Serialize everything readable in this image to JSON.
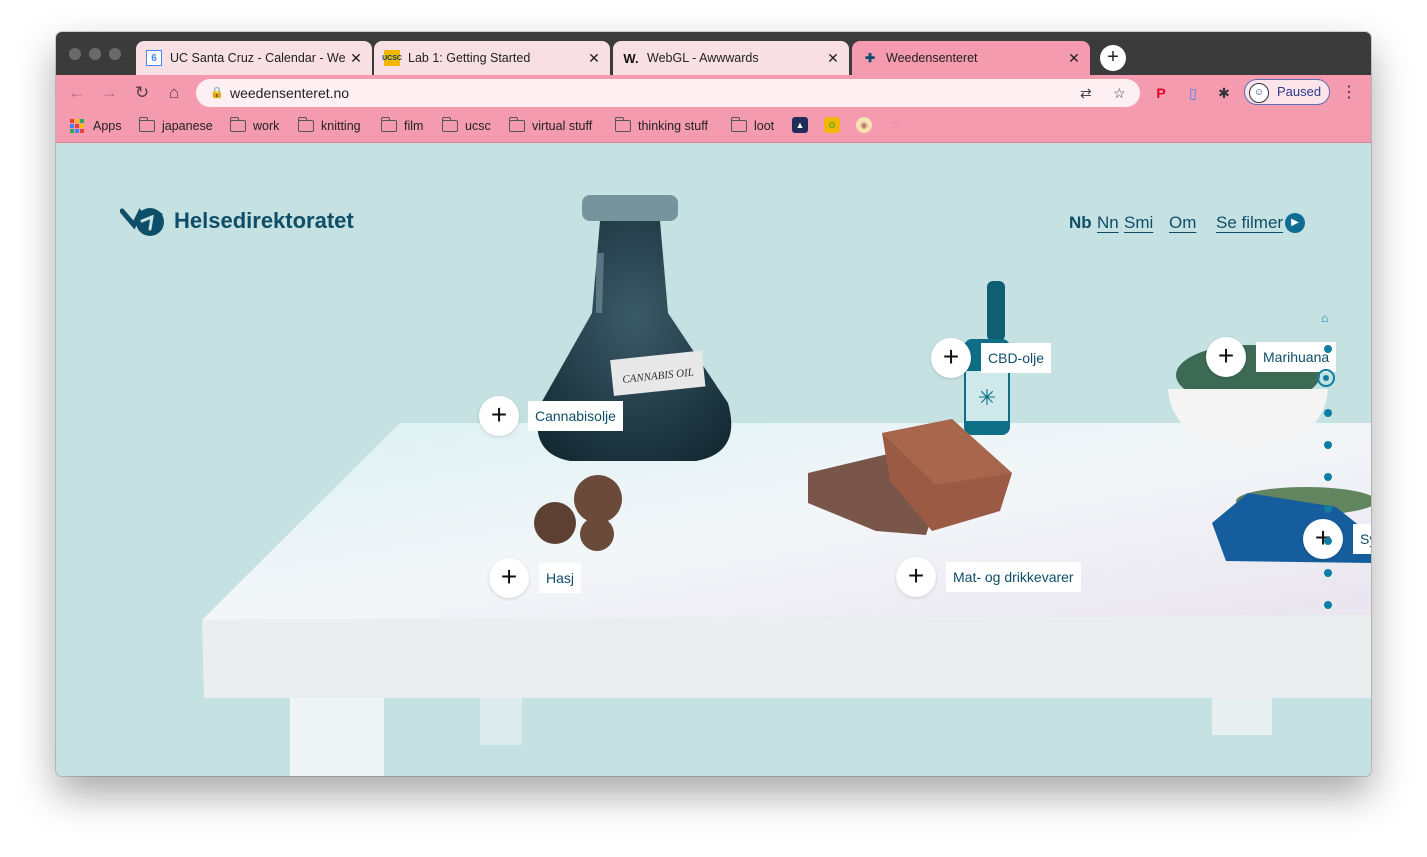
{
  "browser": {
    "tabs": [
      {
        "title": "UC Santa Cruz - Calendar - We",
        "favicon": "calendar-icon",
        "active": false
      },
      {
        "title": "Lab 1: Getting Started",
        "favicon": "ucsc-icon",
        "active": false
      },
      {
        "title": "WebGL - Awwwards",
        "favicon": "w-icon",
        "active": false
      },
      {
        "title": "Weedensenteret",
        "favicon": "helse-icon",
        "active": true
      }
    ],
    "new_tab": "+",
    "url": "weedensenteret.no",
    "profile_status": "Paused",
    "bookmarks": [
      "Apps",
      "japanese",
      "work",
      "knitting",
      "film",
      "ucsc",
      "virtual stuff",
      "thinking stuff",
      "loot"
    ]
  },
  "site": {
    "logo_text": "Helsedirektoratet",
    "nav": {
      "nb": "Nb",
      "nn": "Nn",
      "smi": "Smi",
      "om": "Om",
      "filmer": "Se filmer"
    }
  },
  "scene": {
    "hotspots": [
      {
        "label": "Cannabisolje"
      },
      {
        "label": "Hasj"
      },
      {
        "label": "CBD-olje"
      },
      {
        "label": "Mat- og drikkevarer"
      },
      {
        "label": "Marihuana"
      },
      {
        "label": "Sy"
      }
    ],
    "bottle_label": "CANNABIS OIL"
  }
}
